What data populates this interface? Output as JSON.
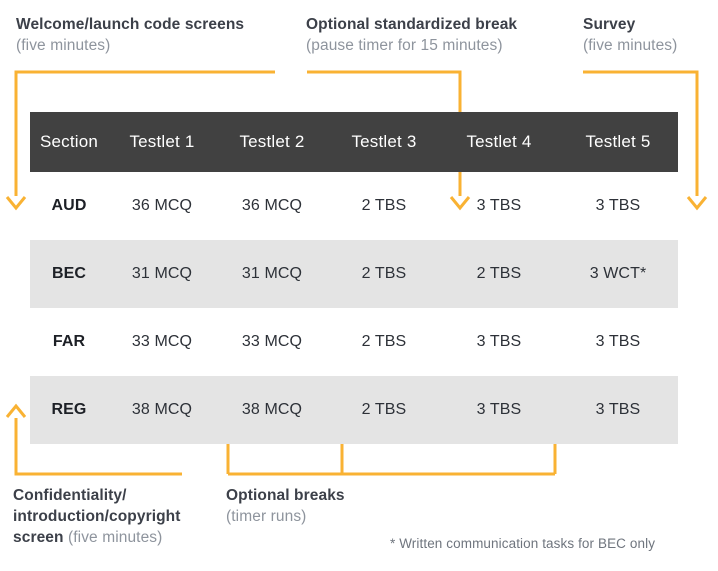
{
  "accent_color": "#f9b233",
  "header_bg": "#414141",
  "row_shade": "#e4e4e4",
  "callouts": {
    "welcome": {
      "line1": "Welcome/launch code screens",
      "line2": "(five minutes)"
    },
    "standardized_break": {
      "line1": "Optional standardized break",
      "line2": "(pause timer for 15 minutes)"
    },
    "survey": {
      "line1": "Survey",
      "line2": "(five minutes)"
    },
    "confidentiality": {
      "line1": "Confidentiality/",
      "line2": "introduction/copyright",
      "line3_strong": "screen",
      "line3_muted": " (five minutes)"
    },
    "optional_breaks": {
      "line1": "Optional breaks",
      "line2": "(timer runs)"
    }
  },
  "footnote": "* Written communication tasks for BEC only",
  "chart_data": {
    "type": "table",
    "title": "CPA Exam section testlet structure",
    "columns": [
      "Section",
      "Testlet 1",
      "Testlet 2",
      "Testlet 3",
      "Testlet 4",
      "Testlet 5"
    ],
    "rows": [
      {
        "shaded": false,
        "cells": [
          "AUD",
          "36 MCQ",
          "36 MCQ",
          "2 TBS",
          "3 TBS",
          "3 TBS"
        ]
      },
      {
        "shaded": true,
        "cells": [
          "BEC",
          "31 MCQ",
          "31 MCQ",
          "2 TBS",
          "2 TBS",
          "3 WCT*"
        ]
      },
      {
        "shaded": false,
        "cells": [
          "FAR",
          "33 MCQ",
          "33 MCQ",
          "2 TBS",
          "3 TBS",
          "3 TBS"
        ]
      },
      {
        "shaded": true,
        "cells": [
          "REG",
          "38 MCQ",
          "38 MCQ",
          "2 TBS",
          "3 TBS",
          "3 TBS"
        ]
      }
    ],
    "annotations": [
      "Welcome/launch code screens (five minutes)",
      "Optional standardized break (pause timer for 15 minutes)",
      "Survey (five minutes)",
      "Confidentiality/introduction/copyright screen (five minutes)",
      "Optional breaks (timer runs)",
      "* Written communication tasks for BEC only"
    ]
  }
}
